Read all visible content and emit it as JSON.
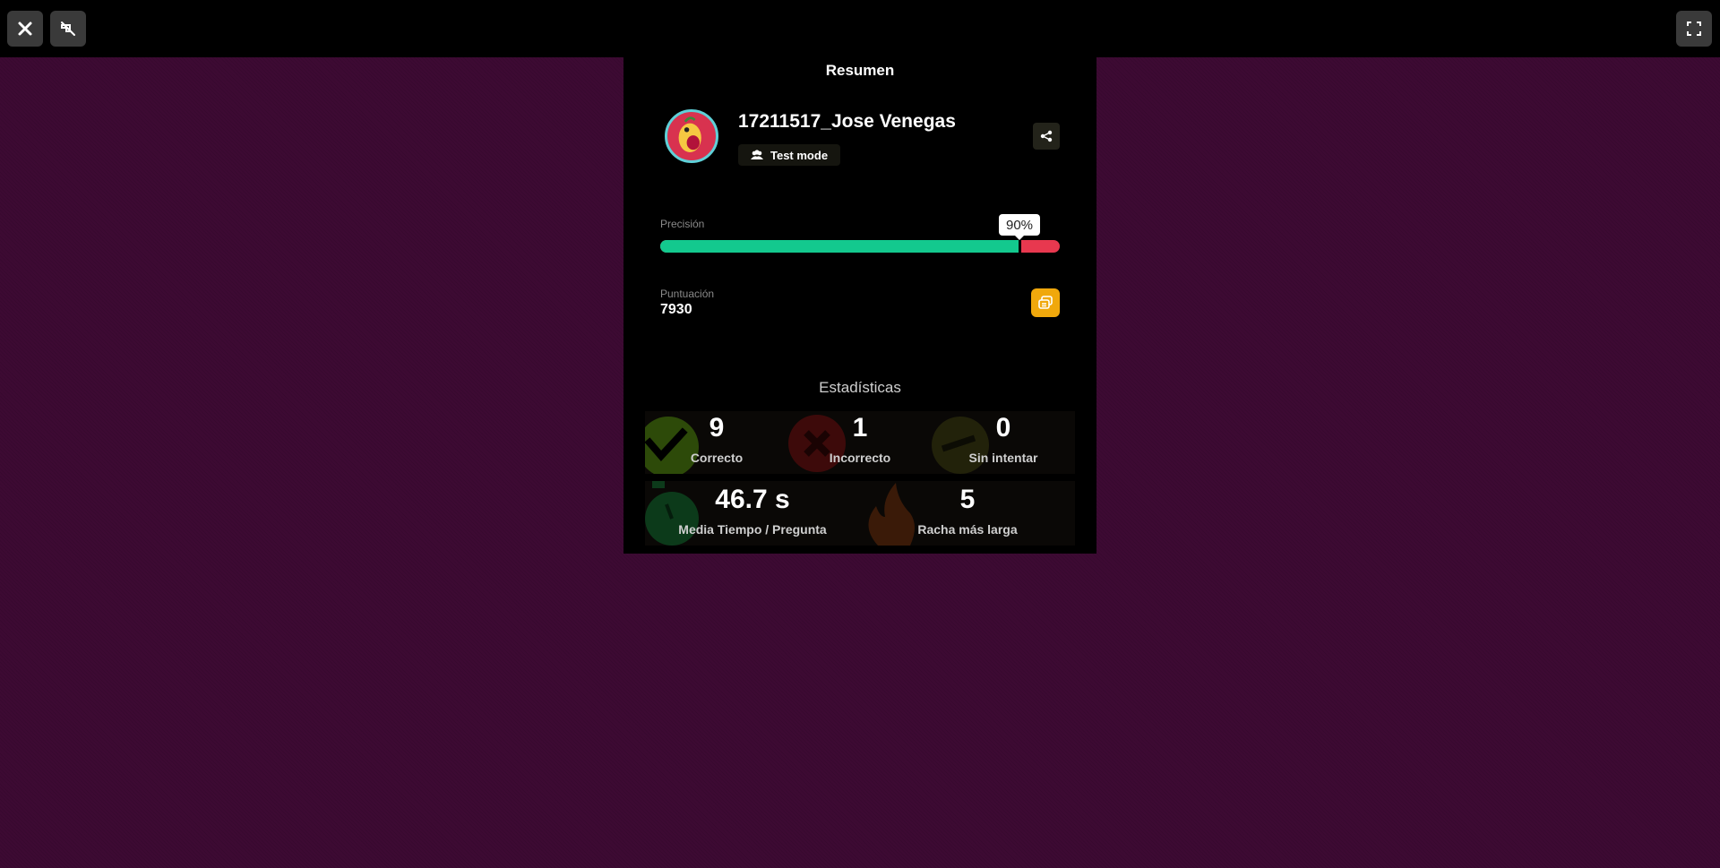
{
  "toolbar": {
    "close_icon": "close-icon",
    "mute_icon": "music-off-icon",
    "fullscreen_icon": "fullscreen-icon"
  },
  "summary": {
    "title": "Resumen",
    "username": "17211517_Jose Venegas",
    "mode": "Test mode",
    "accuracy_label": "Precisión",
    "accuracy_value": "90%",
    "accuracy_fraction": 0.9,
    "score_label": "Puntuación",
    "score_value": "7930"
  },
  "stats": {
    "title": "Estadísticas",
    "correct": {
      "value": "9",
      "label": "Correcto"
    },
    "incorrect": {
      "value": "1",
      "label": "Incorrecto"
    },
    "unattempted": {
      "value": "0",
      "label": "Sin intentar"
    },
    "avg_time": {
      "value": "46.7 s",
      "label": "Media Tiempo / Pregunta"
    },
    "streak": {
      "value": "5",
      "label": "Racha más larga"
    }
  },
  "colors": {
    "background": "#3d0a33",
    "correct": "#13c98e",
    "incorrect": "#e8384f",
    "score_button": "#f0a80c"
  }
}
